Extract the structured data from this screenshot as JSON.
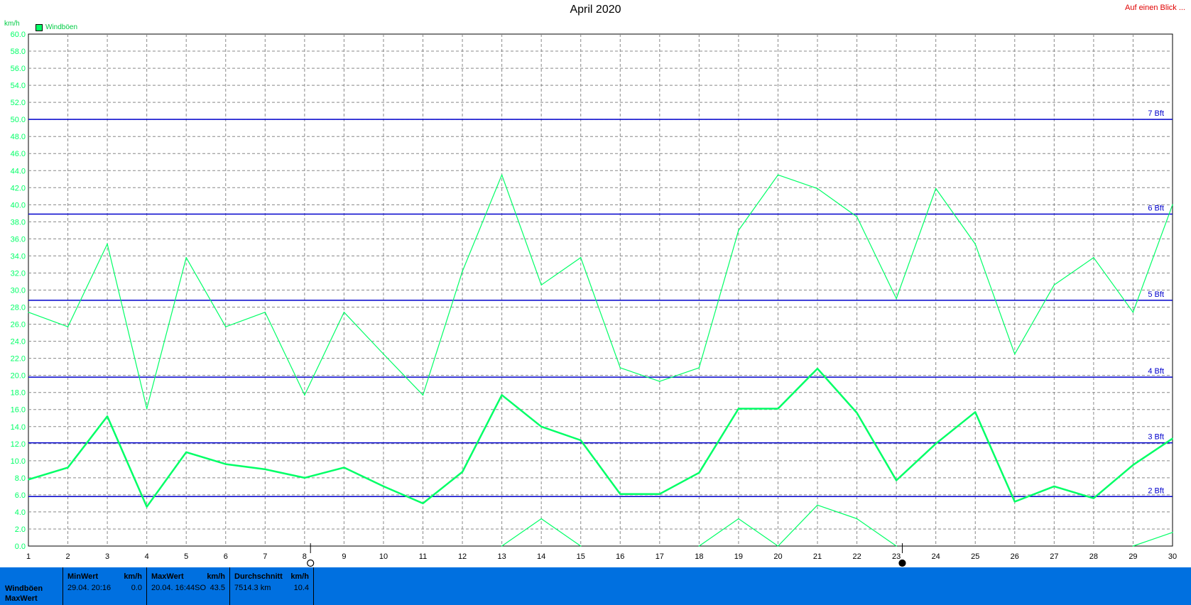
{
  "header": {
    "title": "April 2020",
    "glance_link": "Auf einen Blick ...",
    "unit": "km/h",
    "legend_label": "Windböen"
  },
  "colors": {
    "series": "#00ff66",
    "beaufort": "#0000cc",
    "grid": "#888888",
    "footer_bg": "#0070e0",
    "link": "#e00000"
  },
  "chart_data": {
    "type": "line",
    "title": "April 2020",
    "ylabel": "km/h",
    "xlabel": "",
    "ylim": [
      0,
      60
    ],
    "xlim": [
      1,
      30
    ],
    "y_ticks": [
      "0.0",
      "2.0",
      "4.0",
      "6.0",
      "8.0",
      "10.0",
      "12.0",
      "14.0",
      "16.0",
      "18.0",
      "20.0",
      "22.0",
      "24.0",
      "26.0",
      "28.0",
      "30.0",
      "32.0",
      "34.0",
      "36.0",
      "38.0",
      "40.0",
      "42.0",
      "44.0",
      "46.0",
      "48.0",
      "50.0",
      "52.0",
      "54.0",
      "56.0",
      "58.0",
      "60.0"
    ],
    "x": [
      1,
      2,
      3,
      4,
      5,
      6,
      7,
      8,
      9,
      10,
      11,
      12,
      13,
      14,
      15,
      16,
      17,
      18,
      19,
      20,
      21,
      22,
      23,
      24,
      25,
      26,
      27,
      28,
      29,
      30
    ],
    "grid": true,
    "legend": "top-left",
    "series": [
      {
        "name": "Windböen",
        "role": "max",
        "values": [
          27.4,
          25.7,
          35.4,
          16.1,
          33.8,
          25.7,
          27.4,
          17.7,
          27.4,
          22.5,
          17.7,
          32.2,
          43.5,
          30.6,
          33.8,
          20.9,
          19.3,
          20.9,
          37.0,
          43.5,
          41.9,
          38.6,
          29.0,
          41.9,
          35.4,
          22.5,
          30.6,
          33.8,
          27.4,
          40.0
        ]
      },
      {
        "name": "",
        "role": "mean",
        "values": [
          7.8,
          9.2,
          15.2,
          4.6,
          11.0,
          9.6,
          9.0,
          8.0,
          9.2,
          7.0,
          5.0,
          8.7,
          17.7,
          14.0,
          12.4,
          6.1,
          6.1,
          8.6,
          16.1,
          16.1,
          20.8,
          15.6,
          7.7,
          12.0,
          15.7,
          5.2,
          7.0,
          5.6,
          9.5,
          12.6
        ]
      },
      {
        "name": "",
        "role": "min",
        "values": [
          null,
          null,
          null,
          null,
          null,
          null,
          null,
          null,
          null,
          null,
          null,
          null,
          0.0,
          3.2,
          0.0,
          null,
          null,
          0.0,
          3.2,
          0.0,
          4.8,
          3.2,
          0.0,
          null,
          null,
          null,
          null,
          null,
          0.0,
          1.6
        ]
      }
    ],
    "beaufort_lines": [
      {
        "label": "2 Bft",
        "value": 5.8
      },
      {
        "label": "3 Bft",
        "value": 12.1
      },
      {
        "label": "4 Bft",
        "value": 19.8
      },
      {
        "label": "5 Bft",
        "value": 28.8
      },
      {
        "label": "6 Bft",
        "value": 38.9
      },
      {
        "label": "7 Bft",
        "value": 50.0
      }
    ],
    "markers": [
      {
        "x": 8.15,
        "type": "hollow-circle"
      },
      {
        "x": 23.15,
        "type": "filled-circle"
      }
    ]
  },
  "footer": {
    "row_labels": [
      "Windböen",
      "MaxWert"
    ],
    "panels": [
      {
        "header": "MinWert",
        "unit": "km/h",
        "detail": "29.04.  20:16",
        "value": "0.0"
      },
      {
        "header": "MaxWert",
        "unit": "km/h",
        "detail": "20.04.  16:44SO",
        "value": "43.5"
      },
      {
        "header": "Durchschnitt",
        "unit": "km/h",
        "detail": "7514.3 km",
        "value": "10.4"
      }
    ]
  }
}
